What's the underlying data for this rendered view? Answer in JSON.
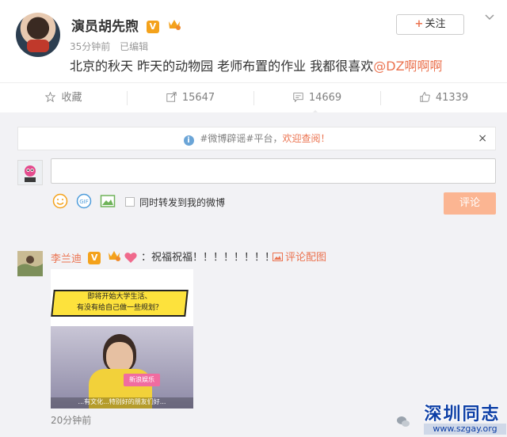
{
  "post": {
    "author": "演员胡先煦",
    "verified_badge": "V",
    "time": "35分钟前",
    "edited": "已编辑",
    "content_text": "北京的秋天 昨天的动物园 老师布置的作业 我都很喜欢",
    "mention": "@DZ啊啊啊",
    "follow_label": "关注",
    "follow_plus": "+"
  },
  "actions": {
    "favorite": "收藏",
    "repost": "15647",
    "comment": "14669",
    "like": "41339"
  },
  "comment_box": {
    "notice_prefix": "#微博辟谣#平台，",
    "notice_link": "欢迎查阅！",
    "close": "×",
    "repost_label": "同时转发到我的微博",
    "submit_label": "评论"
  },
  "comment": {
    "author": "李兰迪",
    "verified_badge": "V",
    "text": "：祝福祝福！！！！！！！！",
    "pic_link": "评论配图",
    "image_caption_1": "即将开始大学生活、",
    "image_caption_2": "有没有给自己做一些规划？",
    "image_badge": "新浪娱乐",
    "image_subtitle": "...有文化...特别好的朋友们好...",
    "time": "20分钟前"
  },
  "watermark": {
    "title": "深圳同志",
    "url": "www.szgay.org"
  },
  "colors": {
    "accent": "#eb7350",
    "submit_disabled": "#fbb592",
    "verified": "#f4a21b"
  }
}
